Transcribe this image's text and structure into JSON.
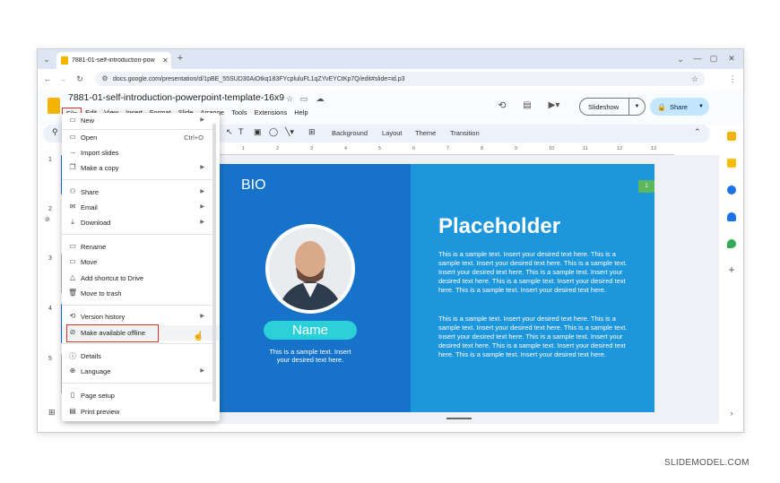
{
  "browser": {
    "tab_title": "7881-01-self-introduction-pow",
    "url": "docs.google.com/presentation/d/1pBE_55SUD30AiOtkq183FYcpluluFL1qZYvEYCtKp7Q/edit#slide=id.p3"
  },
  "doc": {
    "title": "7881-01-self-introduction-powerpoint-template-16x9",
    "menus": [
      "File",
      "Edit",
      "View",
      "Insert",
      "Format",
      "Slide",
      "Arrange",
      "Tools",
      "Extensions",
      "Help"
    ],
    "slideshow_label": "Slideshow",
    "share_label": "Share"
  },
  "toolbar": {
    "background": "Background",
    "layout": "Layout",
    "theme": "Theme",
    "transition": "Transition"
  },
  "ruler": [
    "1",
    "2",
    "3",
    "4",
    "5",
    "6",
    "7",
    "8",
    "9",
    "10",
    "11",
    "12",
    "13"
  ],
  "thumbnails": [
    "1",
    "2",
    "3",
    "4",
    "5"
  ],
  "file_menu": {
    "items": [
      {
        "label": "New",
        "icon": "new-icon",
        "arrow": true
      },
      {
        "label": "Open",
        "icon": "folder-icon",
        "shortcut": "Ctrl+O"
      },
      {
        "label": "Import slides",
        "icon": "import-icon"
      },
      {
        "label": "Make a copy",
        "icon": "copy-icon",
        "arrow": true
      },
      {
        "label": "Share",
        "icon": "share-icon",
        "arrow": true
      },
      {
        "label": "Email",
        "icon": "email-icon",
        "arrow": true
      },
      {
        "label": "Download",
        "icon": "download-icon",
        "arrow": true
      },
      {
        "label": "Rename",
        "icon": "rename-icon"
      },
      {
        "label": "Move",
        "icon": "move-icon"
      },
      {
        "label": "Add shortcut to Drive",
        "icon": "drive-shortcut-icon"
      },
      {
        "label": "Move to trash",
        "icon": "trash-icon"
      },
      {
        "label": "Version history",
        "icon": "history-icon",
        "arrow": true
      },
      {
        "label": "Make available offline",
        "icon": "offline-icon"
      },
      {
        "label": "Details",
        "icon": "info-icon"
      },
      {
        "label": "Language",
        "icon": "globe-icon",
        "arrow": true
      },
      {
        "label": "Page setup",
        "icon": "page-setup-icon"
      },
      {
        "label": "Print preview",
        "icon": "print-preview-icon"
      }
    ]
  },
  "slide": {
    "bio": "BIO",
    "name": "Name",
    "small_text": "This is a sample text. Insert your desired text here.",
    "heading": "Placeholder",
    "paragraph1": "This is a sample text. Insert your desired text here. This is a sample text. Insert your desired text here. This is a sample text. Insert your desired text here. This is a sample text. Insert your desired text here. This is a sample text. Insert your desired text here. This is a sample text. Insert your desired text here.",
    "paragraph2": "This is a sample text. Insert your desired text here. This is a sample text. Insert your desired text here. This is a sample text. Insert your desired text here. This is a sample text. Insert your desired text here. This is a sample text. Insert your desired text here. This is a sample text. Insert your desired text here.",
    "number_badge": "1"
  },
  "watermark": "SLIDEMODEL.COM",
  "colors": {
    "accent": "#1a73e8",
    "highlight": "#d93025",
    "slide_left": "#1673c9",
    "slide_right": "#1e96dc",
    "name_pill": "#2cd0d8"
  }
}
